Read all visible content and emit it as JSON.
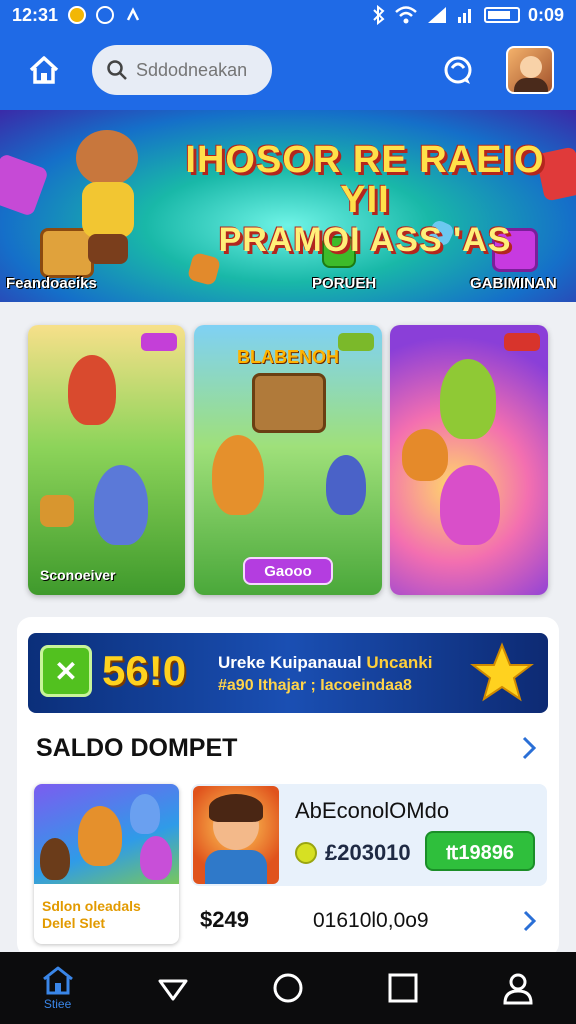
{
  "status_bar": {
    "time": "12:31",
    "battery": "0:09"
  },
  "header": {
    "search_placeholder": "Sddodneakan"
  },
  "banner": {
    "title_line1": "IHOSOR RE RAEIO YII",
    "title_line2": "PRAMOI ASS 'AS",
    "labels": [
      "Feandoaeiks",
      "PORUEH",
      "GABIMINAN"
    ]
  },
  "games": [
    {
      "tag": "",
      "title": "",
      "caption": "Sconoeiver"
    },
    {
      "tag": "",
      "title": "BLABENOH",
      "button": "Gaooo"
    },
    {
      "tag": "",
      "title": "",
      "caption": ""
    }
  ],
  "wallet": {
    "bonus": {
      "amount": "56!0",
      "line1_a": "Ureke Kuipanaual",
      "line1_b": "Uncanki",
      "line2": "#a90 Ithajar ; Iacoeindaa8"
    },
    "title": "SALDO DOMPET",
    "thumb_caption": "Sdlon oleadals Delel Slet",
    "account": {
      "name": "AbEconolOMdo",
      "balance": "£203010",
      "topup_label": "₶19896"
    },
    "price": "$249",
    "transaction_id": "01610l0,0o9"
  },
  "navbar": {
    "home_label": "Stiee"
  },
  "colors": {
    "primary": "#1f6ae6",
    "topup": "#2fbf3c",
    "navbar": "#0c0c0d"
  }
}
